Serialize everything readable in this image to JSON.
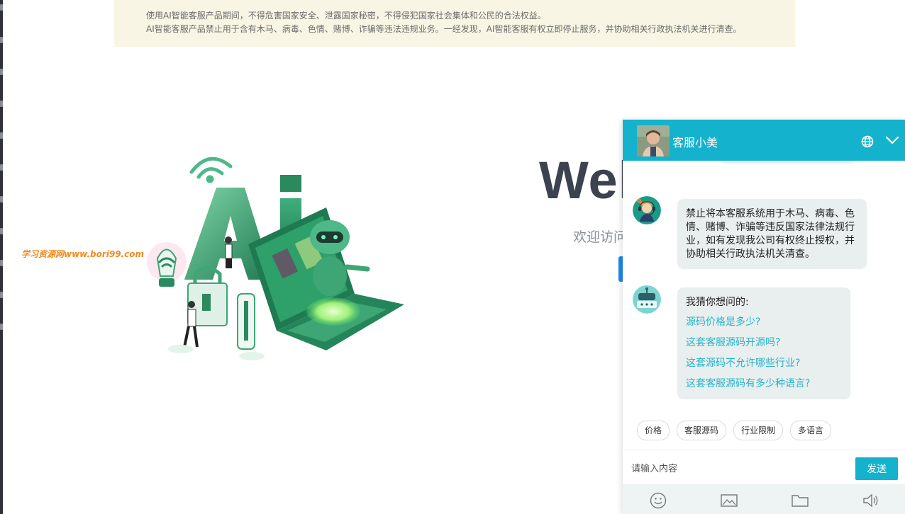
{
  "notice": {
    "line1": "使用AI智能客服产品期间，不得危害国家安全、泄露国家秘密，不得侵犯国家社会集体和公民的合法权益。",
    "line2": "AI智能客服产品禁止用于含有木马、病毒、色情、赌博、诈骗等违法违规业务。一经发现，AI智能客服有权立即停止服务，并协助相关行政执法机关进行清查。"
  },
  "watermark": "学习资源网www.bori99.com",
  "hero": {
    "title": "Wel",
    "subtitle": "欢迎访问"
  },
  "chat": {
    "agent_name": "客服小美",
    "messages": [
      {
        "text": "禁止将本客服系统用于木马、病毒、色情、赌博、诈骗等违反国家法律法规行业，如有发现我公司有权终止授权，并协助相关行政执法机关清查。"
      },
      {
        "lead": "我猜你想问的:",
        "questions": [
          "源码价格是多少?",
          "这套客服源码开源吗?",
          "这套源码不允许哪些行业?",
          "这套客服源码有多少种语言?"
        ]
      }
    ],
    "quick_tags": [
      "价格",
      "客服源码",
      "行业限制",
      "多语言"
    ],
    "input_placeholder": "请输入内容",
    "send_label": "发送"
  },
  "colors": {
    "chat_accent": "#14b2cc",
    "link": "#27b3c9",
    "notice_bg": "#f8f5e4",
    "watermark": "#f3891d"
  },
  "icons": [
    "globe-icon",
    "chevron-down-icon",
    "emoji-icon",
    "image-icon",
    "folder-icon",
    "speaker-icon"
  ]
}
